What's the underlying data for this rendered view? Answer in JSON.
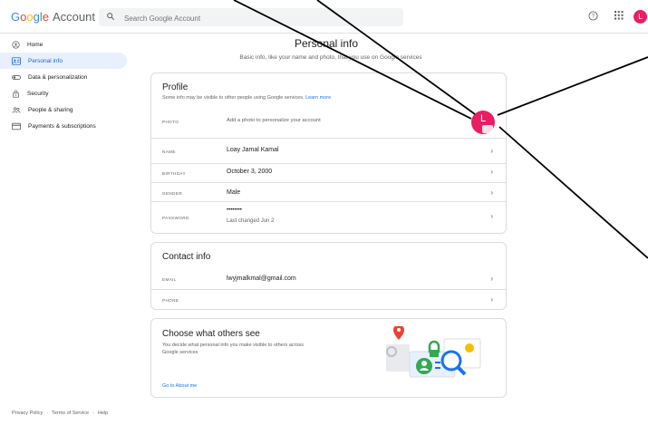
{
  "header": {
    "logo_google": [
      "G",
      "o",
      "o",
      "g",
      "l",
      "e"
    ],
    "logo_account": "Account",
    "search_placeholder": "Search Google Account",
    "avatar_letter": "L"
  },
  "sidebar": {
    "items": [
      {
        "label": "Home",
        "icon": "home-icon"
      },
      {
        "label": "Personal info",
        "icon": "personal-info-icon",
        "active": true
      },
      {
        "label": "Data & personalization",
        "icon": "toggle-icon"
      },
      {
        "label": "Security",
        "icon": "lock-icon"
      },
      {
        "label": "People & sharing",
        "icon": "people-icon"
      },
      {
        "label": "Payments & subscriptions",
        "icon": "card-icon"
      }
    ],
    "footer": [
      "Privacy Policy",
      "·",
      "Terms of Service",
      "·",
      "Help"
    ]
  },
  "page": {
    "title": "Personal info",
    "subtitle": "Basic info, like your name and photo, that you use on Google services"
  },
  "profile": {
    "title": "Profile",
    "desc": "Some info may be visible to other people using Google services.",
    "learn_more": "Learn more",
    "avatar_letter": "L",
    "rows": [
      {
        "label": "PHOTO",
        "value": "Add a photo to personalize your account"
      },
      {
        "label": "NAME",
        "value": "Loay Jamal Kamal"
      },
      {
        "label": "BIRTHDAY",
        "value": "October 3, 2000"
      },
      {
        "label": "GENDER",
        "value": "Male"
      },
      {
        "label": "PASSWORD",
        "value": "••••••••",
        "sub": "Last changed Jun 2"
      }
    ]
  },
  "contact": {
    "title": "Contact info",
    "rows": [
      {
        "label": "EMAIL",
        "value": "lwyjmalkmal@gmail.com"
      },
      {
        "label": "PHONE",
        "value": ""
      }
    ]
  },
  "others": {
    "title": "Choose what others see",
    "desc_line1": "You decide what personal info you make visible to others across",
    "desc_line2": "Google services",
    "link": "Go to About me"
  },
  "colors": {
    "accent": "#1a73e8",
    "avatar": "#e91e63",
    "active_bg": "#e8f0fe"
  }
}
